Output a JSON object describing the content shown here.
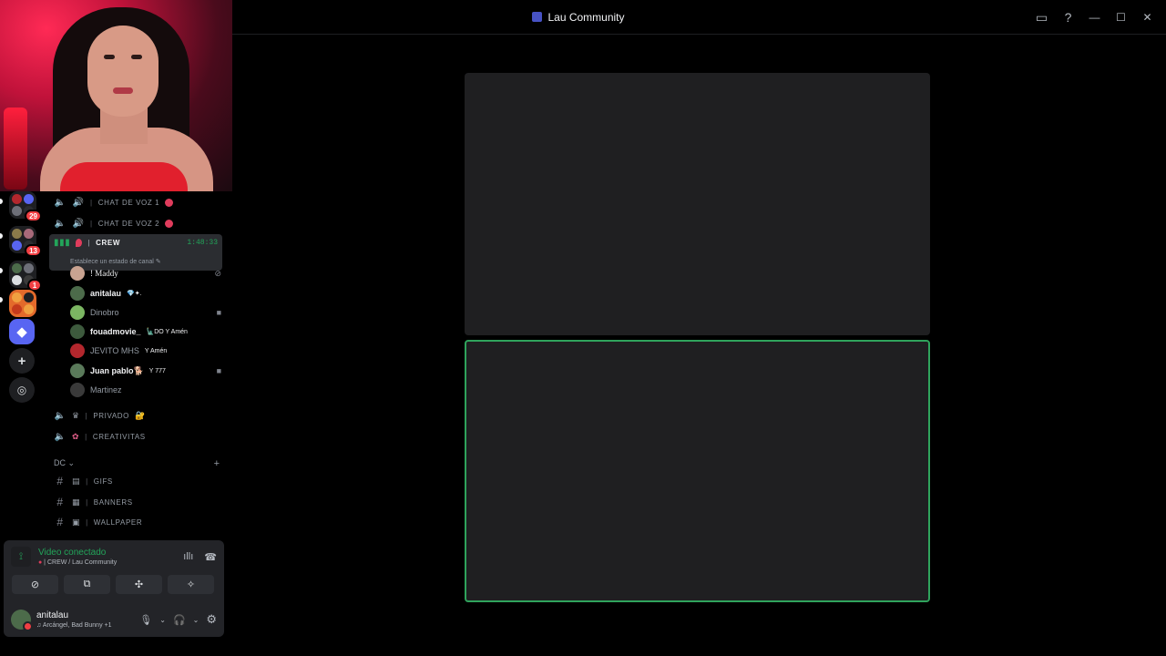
{
  "window": {
    "title": "Lau Community",
    "controls": [
      "inbox-icon",
      "help-icon",
      "minimize",
      "maximize",
      "close"
    ]
  },
  "server_rail": {
    "folders": [
      {
        "badge": "29"
      },
      {
        "badge": "13"
      },
      {
        "badge": "1"
      }
    ]
  },
  "channels": {
    "voice": [
      {
        "name": "CHAT DE VOZ 1"
      },
      {
        "name": "CHAT DE VOZ 2"
      }
    ],
    "active": {
      "name": "CREW",
      "time": "1:48:33",
      "status": "Establece un estado de canal"
    },
    "members": [
      {
        "name": "! Maddy",
        "tag": "",
        "color": "#c9a391"
      },
      {
        "name": "anitalau",
        "tag": "💎✦.",
        "color": "#4c6b4a"
      },
      {
        "name": "Dinobro",
        "tag": "",
        "color": "#7bb662"
      },
      {
        "name": "fouadmovie_",
        "tag": "🗽DO  Y Amén",
        "color": "#3d5a3d"
      },
      {
        "name": "JEVITO MHS",
        "tag": "Y Amén",
        "color": "#b3272d"
      },
      {
        "name": "Juan pablo🐕",
        "tag": "Y 777",
        "color": "#5a7a5a"
      },
      {
        "name": "Martinez",
        "tag": "",
        "color": "#3a3a3a"
      }
    ],
    "more_voice": [
      {
        "name": "PRIVADO",
        "emoji": "🔐"
      },
      {
        "name": "CREATIVITAS",
        "emoji": ""
      }
    ],
    "category": "DC",
    "text": [
      {
        "name": "GIFS"
      },
      {
        "name": "BANNERS"
      },
      {
        "name": "WALLPAPER"
      }
    ]
  },
  "voice_panel": {
    "title": "Video conectado",
    "subtitle": "CREW / Lau Community"
  },
  "user_panel": {
    "name": "anitalau",
    "status": "Arcángel, Bad Bunny +1"
  }
}
